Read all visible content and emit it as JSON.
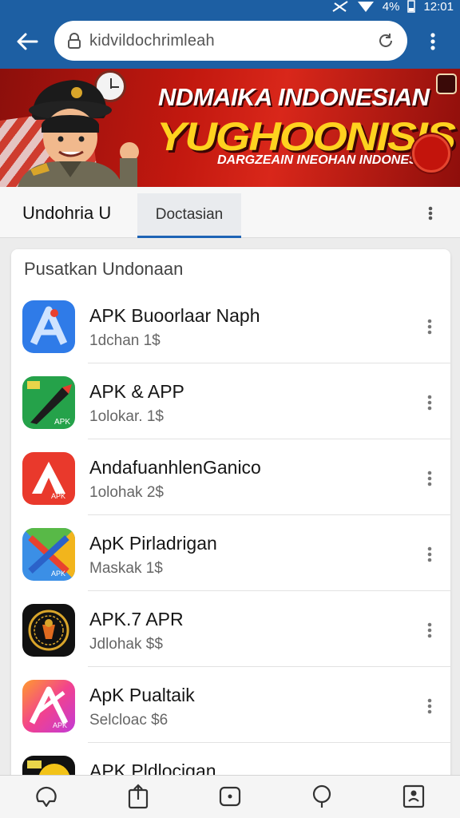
{
  "status_bar": {
    "battery": "4%",
    "time": "12:01"
  },
  "browser": {
    "url": "kidvildochrimleah"
  },
  "banner": {
    "line1": "NDMAIKA INDONESIAN",
    "line2": "YUGHOONISIS",
    "line3": "DARGZEAIN INEOHAN INDONESA"
  },
  "tabs": {
    "left_label": "Undohria U",
    "active_label": "Doctasian"
  },
  "list": {
    "title": "Pusatkan Undonaan",
    "items": [
      {
        "name": "APK Buoorlaar Naph",
        "meta": "1dchan 1$",
        "icon": "blue-a-arrow-icon"
      },
      {
        "name": "APK & APP",
        "meta": "1olokar. 1$",
        "icon": "green-brush-apk-icon"
      },
      {
        "name": "AndafuanhlenGanico",
        "meta": "1olohak 2$",
        "icon": "red-a-apk-icon"
      },
      {
        "name": "ApK Pirladrigan",
        "meta": "Maskak 1$",
        "icon": "colorful-x-apk-icon"
      },
      {
        "name": "APK.7 APR",
        "meta": "Jdlohak $$",
        "icon": "black-gold-emblem-icon"
      },
      {
        "name": "ApK Pualtaik",
        "meta": "Selcloac $6",
        "icon": "gradient-a-apk-icon"
      },
      {
        "name": "APK Pldlocigan",
        "meta": "",
        "icon": "yellow-black-icon"
      }
    ]
  },
  "colors": {
    "toolbar": "#1d5fa3",
    "banner_red": "#c2180f",
    "banner_yellow": "#ffd21f",
    "tab_underline": "#1d63b5"
  }
}
